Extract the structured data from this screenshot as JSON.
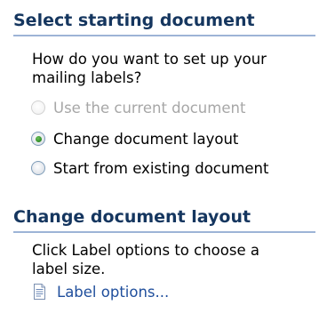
{
  "select_section": {
    "title": "Select starting document",
    "prompt_line1": "How do you want to set up your",
    "prompt_line2": "mailing labels?",
    "options": [
      {
        "label": "Use the current document",
        "state": "disabled"
      },
      {
        "label": "Change document layout",
        "state": "selected"
      },
      {
        "label": "Start from existing document",
        "state": "unselected"
      }
    ]
  },
  "layout_section": {
    "title": "Change document layout",
    "description_line1": "Click Label options to choose a",
    "description_line2": "label size.",
    "link": {
      "label": "Label options...",
      "icon": "document-icon"
    }
  },
  "colors": {
    "header_text": "#15365f",
    "header_rule": "#9db4d6",
    "link": "#1f4e9c",
    "disabled_text": "#a7a7a7",
    "radio_selected": "#2d8a26"
  }
}
